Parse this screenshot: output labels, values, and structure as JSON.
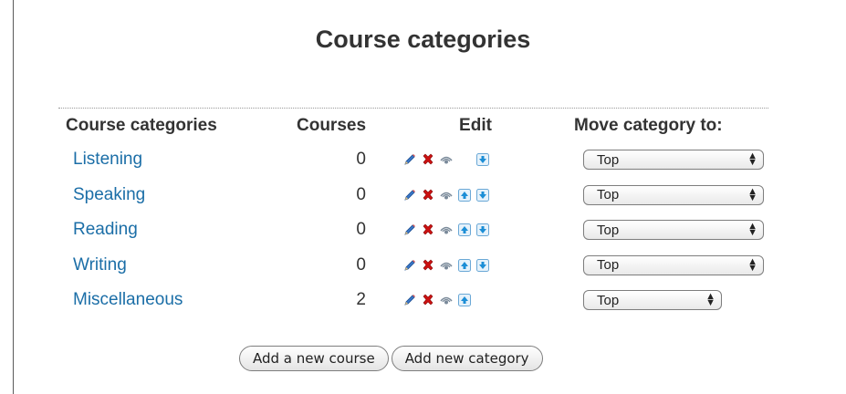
{
  "header": {
    "title": "Course categories"
  },
  "table": {
    "columns": {
      "name": "Course categories",
      "courses": "Courses",
      "edit": "Edit",
      "move": "Move category to:"
    },
    "rows": [
      {
        "name": "Listening",
        "courses": "0",
        "move_to": "Top",
        "has_up": false,
        "has_down": true
      },
      {
        "name": "Speaking",
        "courses": "0",
        "move_to": "Top",
        "has_up": true,
        "has_down": true
      },
      {
        "name": "Reading",
        "courses": "0",
        "move_to": "Top",
        "has_up": true,
        "has_down": true
      },
      {
        "name": "Writing",
        "courses": "0",
        "move_to": "Top",
        "has_up": true,
        "has_down": true
      },
      {
        "name": "Miscellaneous",
        "courses": "2",
        "move_to": "Top",
        "has_up": true,
        "has_down": false
      }
    ]
  },
  "icons": {
    "edit": "pencil-icon",
    "delete": "delete-x-icon",
    "visibility": "eye-icon",
    "move_up": "arrow-up-icon",
    "move_down": "arrow-down-icon"
  },
  "colors": {
    "link": "#1b6ea7",
    "delete": "#cc1111",
    "arrow": "#1c8ed6"
  },
  "actions": {
    "add_course": "Add a new course",
    "add_category": "Add new category"
  }
}
